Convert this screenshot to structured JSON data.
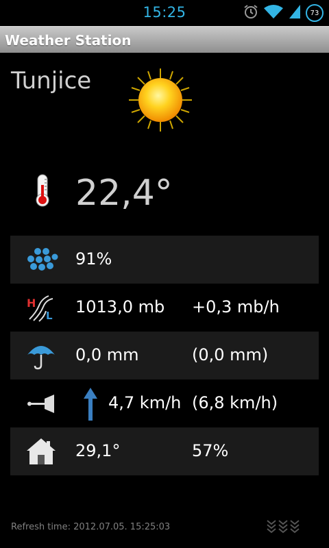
{
  "status_bar": {
    "time": "15:25",
    "battery": "73"
  },
  "app": {
    "title": "Weather Station"
  },
  "location": "Tunjice",
  "temperature": "22,4°",
  "humidity": "91%",
  "pressure": {
    "value": "1013,0 mb",
    "trend": "+0,3 mb/h"
  },
  "rain": {
    "value": "0,0 mm",
    "total": "(0,0 mm)"
  },
  "wind": {
    "speed": "4,7 km/h",
    "gust": "(6,8 km/h)"
  },
  "indoor": {
    "temperature": "29,1°",
    "humidity": "57%"
  },
  "refresh": "Refresh time: 2012.07.05. 15:25:03",
  "colors": {
    "accent": "#33b5e5",
    "row_shade": "#1b1b1b",
    "arrow": "#3a7fc1"
  }
}
